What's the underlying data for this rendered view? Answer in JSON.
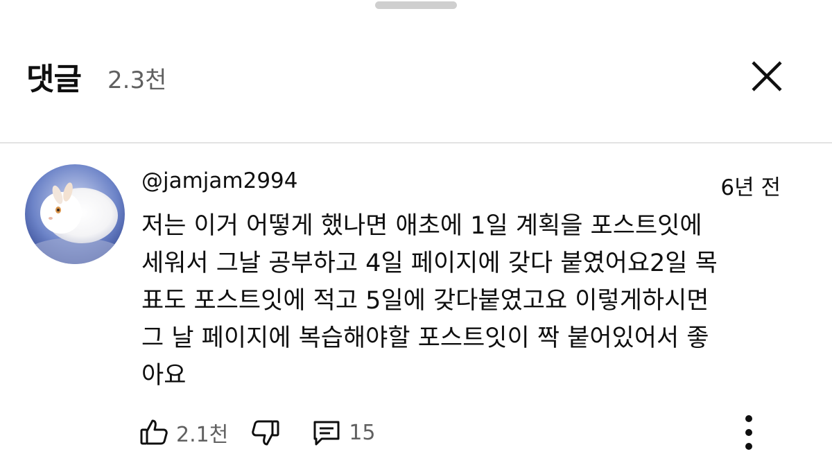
{
  "header": {
    "title": "댓글",
    "count": "2.3천"
  },
  "comment": {
    "author": "@jamjam2994",
    "time": "6년 전",
    "text": "저는 이거 어떻게 했나면 애초에 1일 계획을 포스트잇에\n세워서 그날 공부하고 4일 페이지에 갖다 붙였어요2일 목\n표도 포스트잇에 적고 5일에 갖다붙였고요 이렇게하시면\n그 날 페이지에 복습해야할 포스트잇이 짝 붙어있어서 좋\n아요",
    "likes": "2.1천",
    "replies": "15"
  },
  "icons": {
    "close": "close-icon",
    "like": "thumbs-up-icon",
    "dislike": "thumbs-down-icon",
    "reply": "comment-icon",
    "more": "more-vertical-icon"
  },
  "colors": {
    "text_primary": "#0f0f0f",
    "text_secondary": "#606060",
    "divider": "#e3e3e3"
  }
}
